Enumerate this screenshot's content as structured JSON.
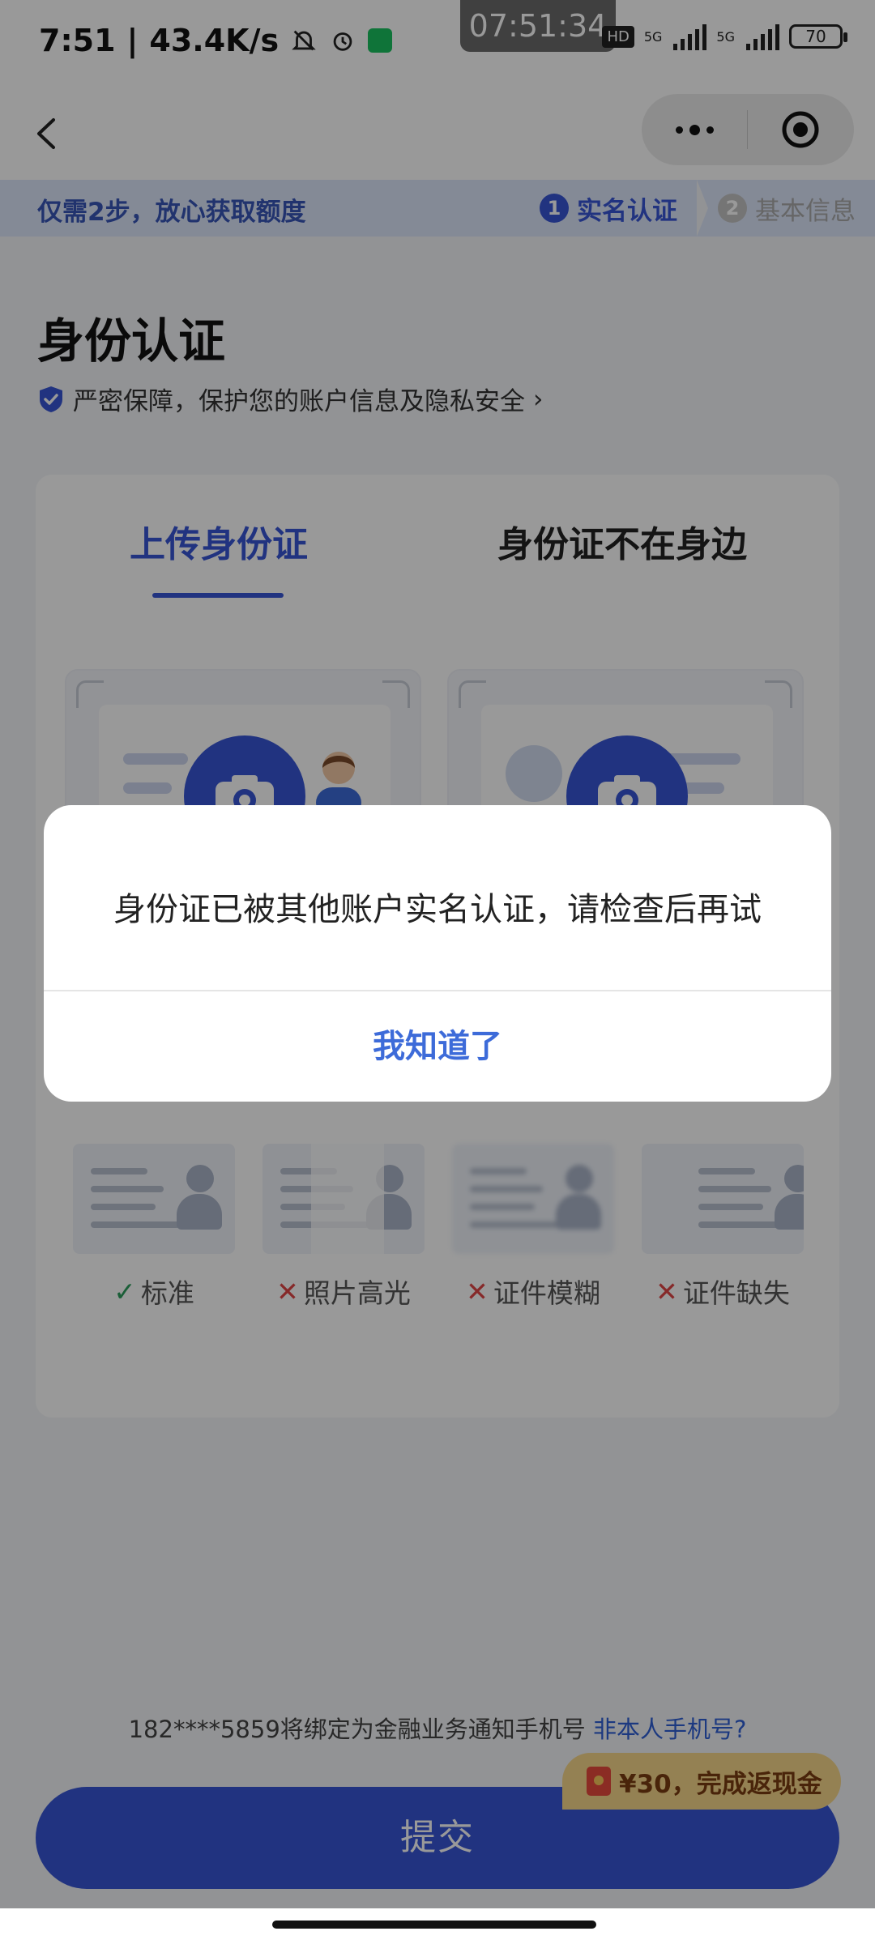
{
  "status_bar": {
    "time": "7:51",
    "speed": "43.4K/s",
    "clock_overlay": "07:51:34",
    "hd_label": "HD",
    "network_1": "5G",
    "network_2": "5G",
    "battery": "70"
  },
  "banner": {
    "text": "仅需2步，放心获取额度",
    "step1_num": "1",
    "step1_label": "实名认证",
    "step2_num": "2",
    "step2_label": "基本信息"
  },
  "header": {
    "title": "身份认证",
    "secure_text": "严密保障，保护您的账户信息及隐私安全",
    "secure_chevron": "›"
  },
  "tabs": {
    "upload": "上传身份证",
    "absent": "身份证不在身边"
  },
  "samples": [
    {
      "mark": "✓",
      "label": "标准",
      "ok": true
    },
    {
      "mark": "✕",
      "label": "照片高光",
      "ok": false
    },
    {
      "mark": "✕",
      "label": "证件模糊",
      "ok": false
    },
    {
      "mark": "✕",
      "label": "证件缺失",
      "ok": false
    }
  ],
  "footer": {
    "bind_text": "182****5859将绑定为金融业务通知手机号",
    "bind_link": "非本人手机号?",
    "cashback": "¥30，完成返现金",
    "submit": "提交"
  },
  "dialog": {
    "message": "身份证已被其他账户实名认证，请检查后再试",
    "confirm": "我知道了"
  },
  "colors": {
    "primary": "#3756d6",
    "link": "#2f5fd6",
    "ok": "#2c9d5d",
    "bad": "#e04545"
  }
}
